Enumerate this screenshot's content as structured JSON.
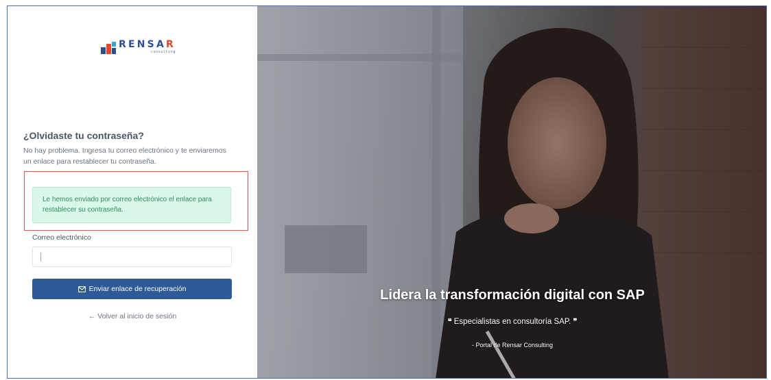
{
  "brand": {
    "name": "RENSAR",
    "tagline": "consulting",
    "colors": {
      "primary": "#2d4e8f",
      "accent": "#e8452c"
    }
  },
  "form": {
    "title": "¿Olvidaste tu contraseña?",
    "description": "No hay problema. Ingresa tu correo electrónico y te enviaremos un enlace para restablecer tu contraseña.",
    "alert_message": "Le hemos enviado por correo electrónico el enlace para restablecer su contraseña.",
    "email_label": "Correo electrónico",
    "email_value": "",
    "submit_label": "Enviar enlace de recuperación",
    "submit_icon": "mail-icon",
    "back_link": "← Volver al inicio de sesión"
  },
  "hero": {
    "title": "Lidera la transformación digital con SAP",
    "quote": "Especialistas en consultoría SAP.",
    "attribution": "- Portal de Rensar Consulting"
  },
  "colors": {
    "button": "#2e5a98",
    "alert_bg": "#d9f8e8",
    "alert_text": "#2f8c63",
    "highlight_border": "#e2534a"
  }
}
